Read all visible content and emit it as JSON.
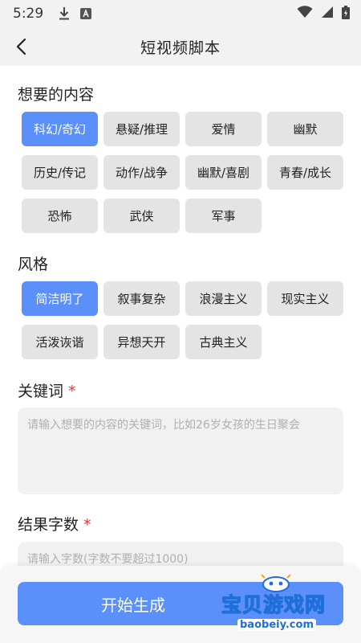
{
  "status_bar": {
    "time": "5:29"
  },
  "app_bar": {
    "title": "短视频脚本"
  },
  "content_section": {
    "title": "想要的内容",
    "options": [
      "科幻/奇幻",
      "悬疑/推理",
      "爱情",
      "幽默",
      "历史/传记",
      "动作/战争",
      "幽默/喜剧",
      "青春/成长",
      "恐怖",
      "武侠",
      "军事"
    ],
    "selected": "科幻/奇幻"
  },
  "style_section": {
    "title": "风格",
    "options": [
      "简洁明了",
      "叙事复杂",
      "浪漫主义",
      "现实主义",
      "活泼诙谐",
      "异想天开",
      "古典主义"
    ],
    "selected": "简洁明了"
  },
  "keywords": {
    "label": "关键词",
    "required_mark": "*",
    "placeholder": "请输入想要的内容的关键词，比如26岁女孩的生日聚会"
  },
  "word_count": {
    "label": "结果字数",
    "required_mark": "*",
    "placeholder": "请输入字数(字数不要超过1000)"
  },
  "start_button": {
    "label": "开始生成"
  },
  "watermark": {
    "name": "宝贝游戏网",
    "url": "baobeiy.com"
  },
  "colors": {
    "accent": "#5b8ff9",
    "chip_bg": "#e4e4e4",
    "required": "#e53935"
  }
}
